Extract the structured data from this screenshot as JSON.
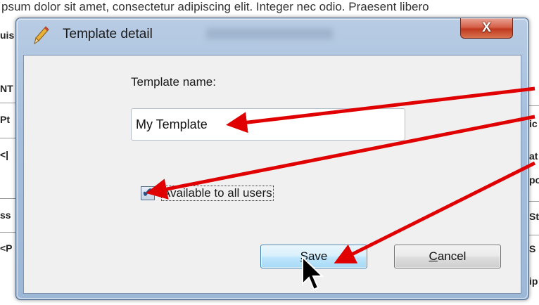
{
  "background": {
    "top_text": "psum dolor sit amet, consectetur adipiscing elit. Integer nec odio. Praesent libero",
    "left_fragments": [
      "uis",
      "NT",
      "Pt",
      "<|",
      "ss",
      "<P"
    ],
    "right_fragments": [
      "ic",
      "at",
      "po",
      "St",
      "S",
      "ip"
    ]
  },
  "window": {
    "title": "Template detail",
    "close_label": "X"
  },
  "form": {
    "name_label": "Template name:",
    "name_value": "My Template",
    "checkbox_label": "Available to all users",
    "checkbox_checked": true,
    "save_label": "Save",
    "cancel_label": "Cancel"
  },
  "colors": {
    "annotation_arrow": "#e00000",
    "title_bar": "#a5bedb",
    "close_button": "#c0391f"
  },
  "icons": {
    "window_icon": "pencil-icon",
    "close_icon": "close-icon",
    "checkmark": "checkmark-icon",
    "pointer": "mouse-pointer-icon"
  }
}
